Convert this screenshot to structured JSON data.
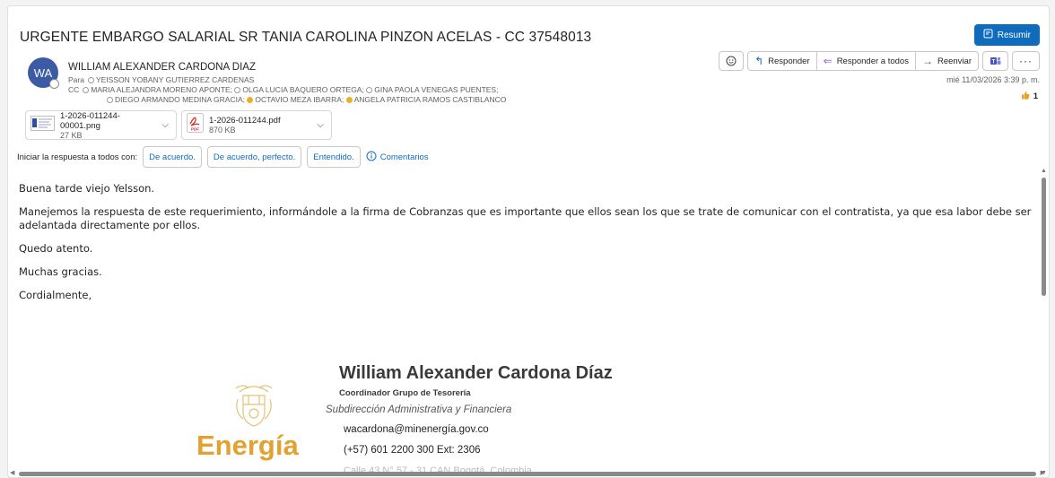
{
  "email": {
    "subject": "URGENTE EMBARGO SALARIAL SR TANIA CAROLINA PINZON ACELAS - CC 37548013",
    "summarize_label": "Resumir",
    "avatar_initials": "WA",
    "sender": "WILLIAM ALEXANDER CARDONA DIAZ",
    "to_label": "Para",
    "to": "YEISSON YOBANY GUTIERREZ CARDENAS",
    "cc_label": "CC",
    "cc_line1": [
      {
        "name": "MARIA ALEJANDRA MORENO APONTE;",
        "status": "away"
      },
      {
        "name": "OLGA LUCIA BAQUERO ORTEGA;",
        "status": "away"
      },
      {
        "name": "GINA PAOLA VENEGAS PUENTES;",
        "status": "away"
      }
    ],
    "cc_line2": [
      {
        "name": "DIEGO ARMANDO MEDINA GRACIA;",
        "status": "away"
      },
      {
        "name": "OCTAVIO MEZA IBARRA;",
        "status": "busy"
      },
      {
        "name": "ANGELA PATRICIA RAMOS CASTIBLANCO",
        "status": "busy"
      }
    ],
    "date": "mié 11/03/2026 3:39 p. m.",
    "reaction_count": "1",
    "actions": {
      "reply": "Responder",
      "reply_all": "Responder a todos",
      "forward": "Reenviar"
    },
    "attachments": [
      {
        "name": "1-2026-011244-00001.png",
        "size": "27 KB"
      },
      {
        "name": "1-2026-011244.pdf",
        "size": "870 KB"
      }
    ],
    "suggest_label": "Iniciar la respuesta a todos con:",
    "suggestions": [
      "De acuerdo.",
      "De acuerdo, perfecto.",
      "Entendido."
    ],
    "comments_label": "Comentarios",
    "body": [
      "Buena tarde viejo Yelsson.",
      "Manejemos la respuesta de este requerimiento, informándole a la firma de Cobranzas que es importante que ellos sean los que se trate de comunicar con el contratista, ya que esa labor debe ser adelantada directamente por ellos.",
      "Quedo atento.",
      "Muchas gracias.",
      "Cordialmente,"
    ],
    "signature": {
      "name": "William Alexander Cardona Díaz",
      "role": "Coordinador Grupo de Tesorería",
      "dept": "Subdirección Administrativa y Financiera",
      "email": "wacardona@minenergía.gov.co",
      "phone": "(+57) 601 2200 300 Ext: 2306",
      "address": "Calle 43 N° 57 - 31 CAN Bogotá, Colombia",
      "logo_text": "Energía"
    }
  },
  "colors": {
    "accent": "#0f6cbd",
    "avatar": "#3b5ba5",
    "logo": "#e3a22f"
  }
}
